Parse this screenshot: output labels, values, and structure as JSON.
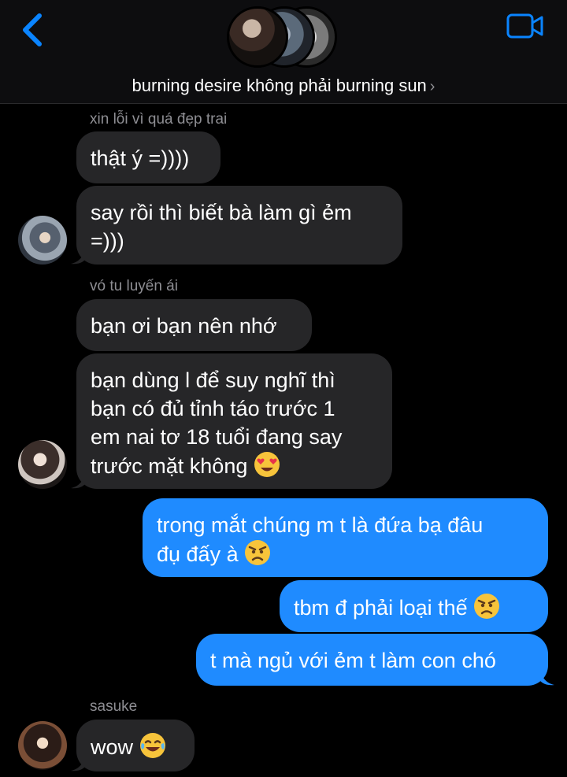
{
  "header": {
    "title": "burning desire không phải burning sun",
    "back_icon": "chevron-left-icon",
    "video_icon": "video-camera-icon",
    "accent": "#0a84ff"
  },
  "messages": {
    "m1_sender": "xin lỗi vì quá đẹp trai",
    "m1_text": "thật ý =))))",
    "m2_text_line1": "say rồi thì biết bà làm gì ẻm",
    "m2_text_line2": "=)))",
    "m3_sender": "vó tu luyến ái",
    "m3_text": "bạn ơi bạn nên nhớ",
    "m4_line1": "bạn dùng l để suy nghĩ thì",
    "m4_line2": "bạn có đủ tỉnh táo trước 1",
    "m4_line3": "em nai tơ 18 tuổi đang say",
    "m4_line4": "trước mặt không",
    "m5_line1": "trong mắt chúng m t là đứa bạ đâu",
    "m5_line2": "đụ đấy à",
    "m6_text": "tbm đ phải loại thế",
    "m7_text": "t mà ngủ với ẻm t làm con chó",
    "m8_sender": "sasuke",
    "m8_text": "wow"
  },
  "colors": {
    "incoming_bubble": "#262628",
    "outgoing_bubble": "#1f8bff",
    "sender_text": "#8e8e93",
    "background": "#000000"
  }
}
